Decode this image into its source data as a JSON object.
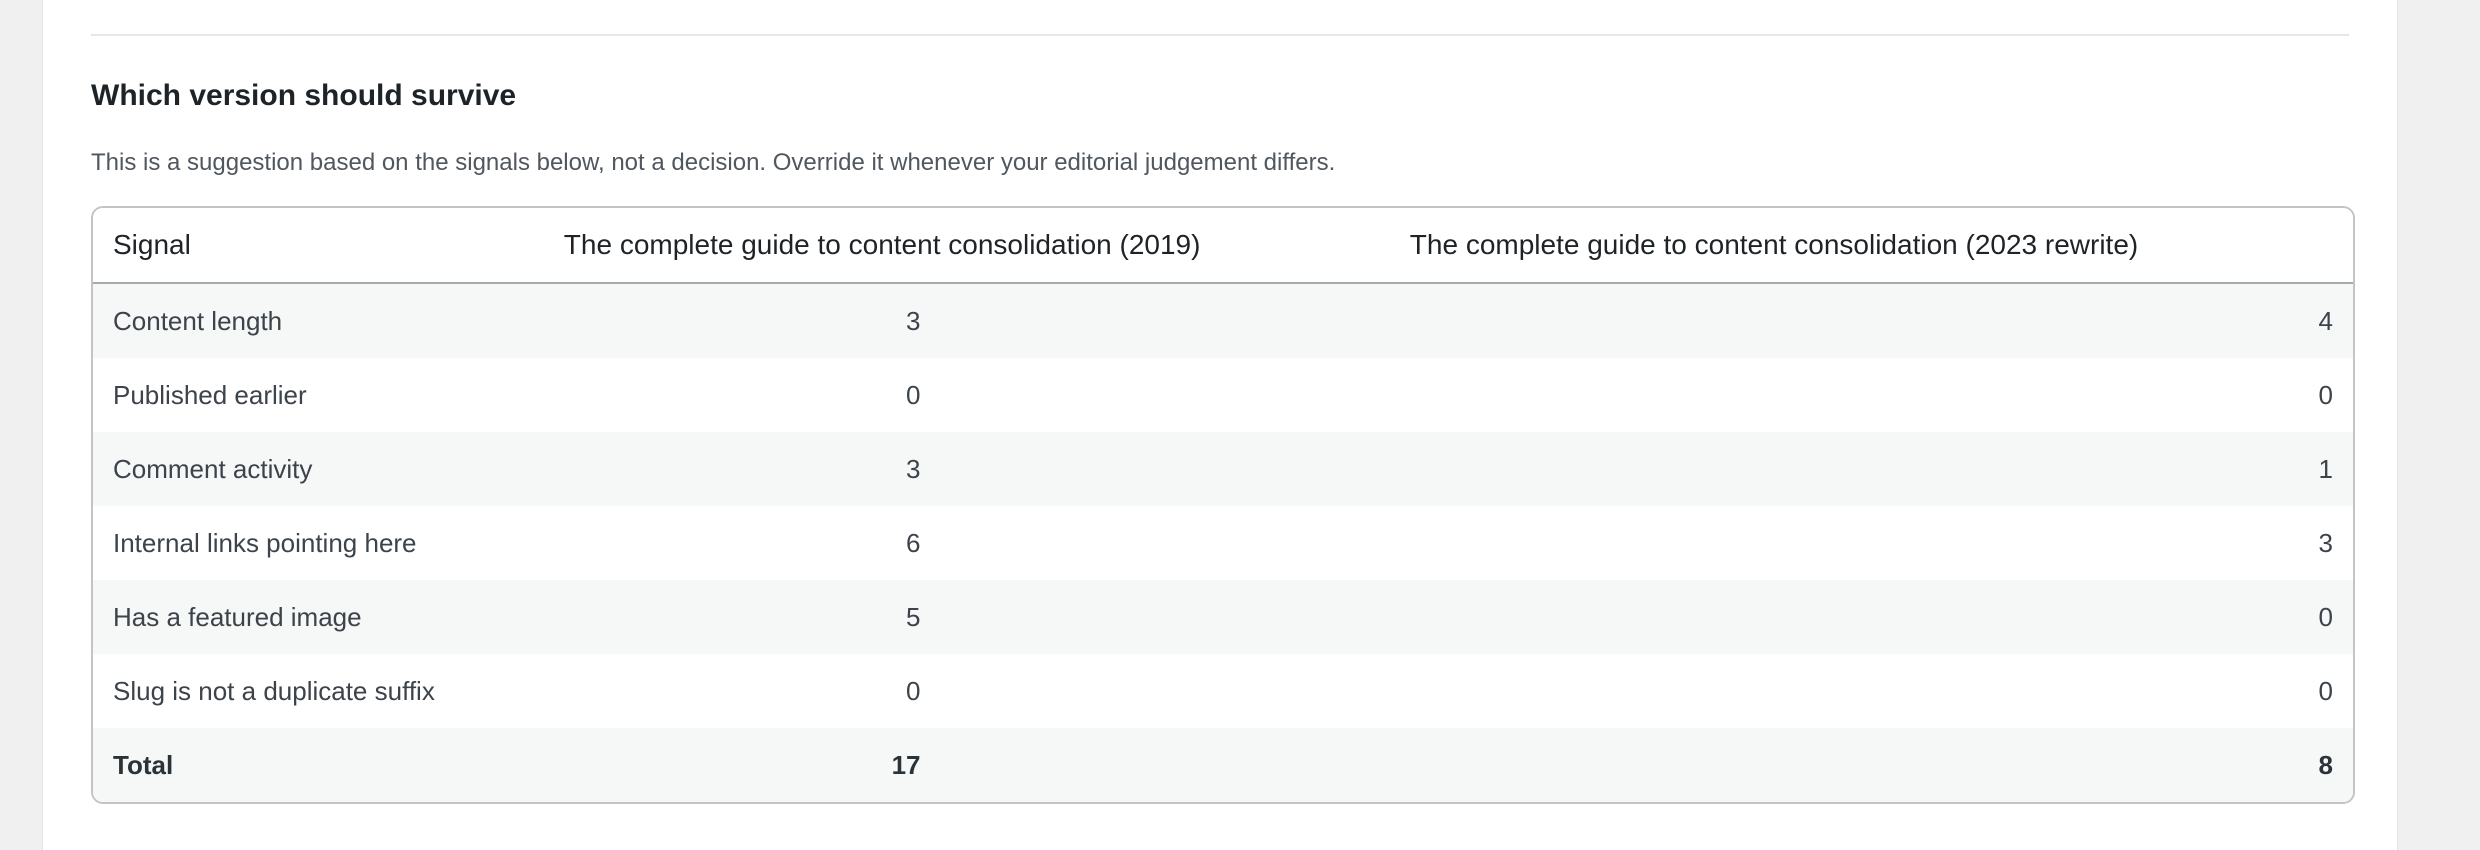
{
  "section": {
    "title": "Which version should survive",
    "description": "This is a suggestion based on the signals below, not a decision. Override it whenever your editorial judgement differs."
  },
  "table": {
    "headers": {
      "signal": "Signal",
      "version_a": "The complete guide to content consolidation (2019)",
      "version_b": "The complete guide to content consolidation (2023 rewrite)"
    },
    "rows": [
      {
        "signal": "Content length",
        "a": "3",
        "b": "4"
      },
      {
        "signal": "Published earlier",
        "a": "0",
        "b": "0"
      },
      {
        "signal": "Comment activity",
        "a": "3",
        "b": "1"
      },
      {
        "signal": "Internal links pointing here",
        "a": "6",
        "b": "3"
      },
      {
        "signal": "Has a featured image",
        "a": "5",
        "b": "0"
      },
      {
        "signal": "Slug is not a duplicate suffix",
        "a": "0",
        "b": "0"
      }
    ],
    "total": {
      "label": "Total",
      "a": "17",
      "b": "8"
    }
  }
}
